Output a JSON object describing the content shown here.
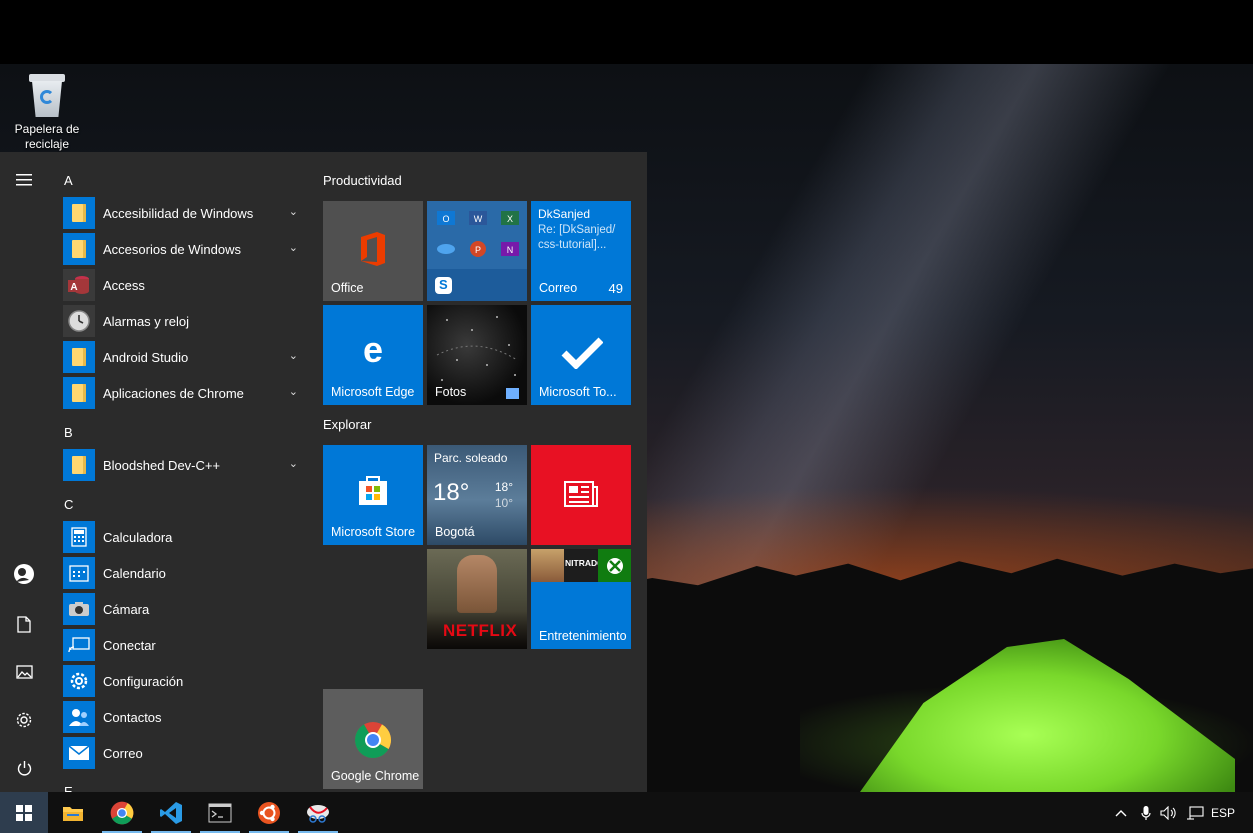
{
  "desktop": {
    "recycle_bin_label_line1": "Papelera de",
    "recycle_bin_label_line2": "reciclaje"
  },
  "start_menu": {
    "rail": {
      "menu_icon": "hamburger-icon",
      "items": [
        {
          "icon": "user-avatar-icon"
        },
        {
          "icon": "documents-icon"
        },
        {
          "icon": "pictures-icon"
        },
        {
          "icon": "settings-icon"
        },
        {
          "icon": "power-icon"
        }
      ]
    },
    "app_list": {
      "letter_a": "A",
      "letter_b": "B",
      "letter_c": "C",
      "letter_e": "E",
      "apps": [
        {
          "name": "Accesibilidad de Windows",
          "icon": "folder-icon",
          "expandable": true
        },
        {
          "name": "Accesorios de Windows",
          "icon": "folder-icon",
          "expandable": true
        },
        {
          "name": "Access",
          "icon": "access-icon",
          "expandable": false
        },
        {
          "name": "Alarmas y reloj",
          "icon": "clock-icon",
          "expandable": false
        },
        {
          "name": "Android Studio",
          "icon": "folder-icon",
          "expandable": true
        },
        {
          "name": "Aplicaciones de Chrome",
          "icon": "folder-icon",
          "expandable": true
        },
        {
          "name": "Bloodshed Dev-C++",
          "icon": "folder-icon",
          "expandable": true
        },
        {
          "name": "Calculadora",
          "icon": "calculator-icon",
          "expandable": false
        },
        {
          "name": "Calendario",
          "icon": "calendar-icon",
          "expandable": false
        },
        {
          "name": "Cámara",
          "icon": "camera-icon",
          "expandable": false
        },
        {
          "name": "Conectar",
          "icon": "connect-icon",
          "expandable": false
        },
        {
          "name": "Configuración",
          "icon": "settings-gear-icon",
          "expandable": false
        },
        {
          "name": "Contactos",
          "icon": "contacts-icon",
          "expandable": false
        },
        {
          "name": "Correo",
          "icon": "mail-icon",
          "expandable": false
        }
      ]
    },
    "groups": {
      "productivity": "Productividad",
      "explore": "Explorar"
    },
    "tiles": {
      "office": "Office",
      "mail_sender": "DkSanjed",
      "mail_subject_line1": "Re: [DkSanjed/",
      "mail_subject_line2": "css-tutorial]...",
      "mail_label": "Correo",
      "mail_count": "49",
      "edge": "Microsoft Edge",
      "photos": "Fotos",
      "todo": "Microsoft To...",
      "store": "Microsoft Store",
      "weather_condition": "Parc. soleado",
      "weather_temp": "18°",
      "weather_high": "18°",
      "weather_low": "10°",
      "weather_city": "Bogotá",
      "netflix": "NETFLIX",
      "entertainment": "Entretenimiento",
      "entertainment_mini": "NITRADO",
      "chrome": "Google Chrome"
    }
  },
  "taskbar": {
    "apps": [
      {
        "icon": "file-explorer-icon"
      },
      {
        "icon": "chrome-icon"
      },
      {
        "icon": "vscode-icon"
      },
      {
        "icon": "terminal-icon"
      },
      {
        "icon": "ubuntu-icon"
      },
      {
        "icon": "snipping-tool-icon"
      }
    ],
    "language": "ESP"
  },
  "colors": {
    "accent": "#0078d7",
    "menu_bg": "#2b2b2b",
    "news_red": "#e81123",
    "folder_yellow": "#ffd770",
    "tent_green": "#79d82b"
  }
}
